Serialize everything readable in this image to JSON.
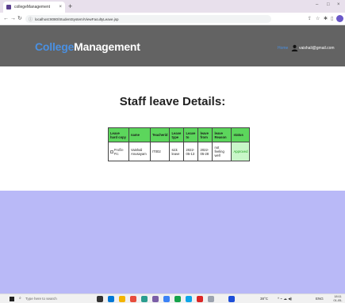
{
  "browser": {
    "tab_title": "collegeManagement",
    "tab_close": "×",
    "new_tab": "+",
    "url": "localhost:8080/StudentSystem/ViewFacultyLeave.jsp",
    "window_controls": [
      "–",
      "□",
      "×"
    ]
  },
  "header": {
    "brand_part1": "College",
    "brand_part2": "Management",
    "nav_home": "Home",
    "user_email": "vaishali@gmail.com"
  },
  "main": {
    "title": "Staff leave Details:",
    "table": {
      "columns": [
        "Leave hard copy",
        "name",
        "Teacherid",
        "Leave type",
        "Leave to",
        "leave from",
        "leave Reason",
        "status"
      ],
      "rows": [
        {
          "hard_copy_alt": "Profile Pic",
          "name": "Vaishali Anusayam",
          "teacher_id": "IT002",
          "leave_type": "sick leave",
          "leave_to": "2022-05-13",
          "leave_from": "2022-05-28",
          "reason": "not feeling well",
          "status": "Approved"
        }
      ]
    }
  },
  "taskbar": {
    "search_placeholder": "Type here to search",
    "weather": "38°C",
    "language": "ENG",
    "time": "18:11",
    "date": "01-05-2022"
  },
  "colors": {
    "header_bg": "#636363",
    "brand_accent": "#4a90e2",
    "table_header_bg": "#5cd65c",
    "status_bg": "#c8f7c8",
    "footer_band": "#b9b9f7"
  }
}
